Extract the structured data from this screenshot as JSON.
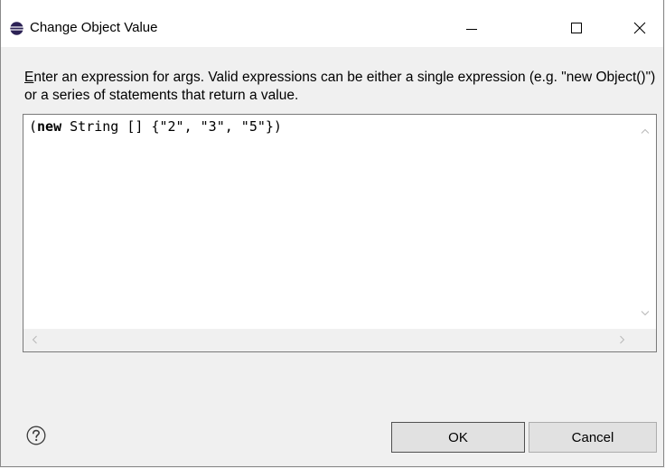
{
  "window": {
    "title": "Change Object Value",
    "icon": "eclipse-icon",
    "controls": {
      "minimize": "minimize-icon",
      "maximize": "maximize-icon",
      "close": "close-icon"
    }
  },
  "instructions": {
    "accel": "E",
    "text_rest": "nter an expression for args. Valid expressions can be either a single expression (e.g. \"new Object()\") or a series of statements that return a value."
  },
  "editor": {
    "keyword": "new",
    "open_paren": "(",
    "code_rest": " String [] {\"2\", \"3\", \"5\"})"
  },
  "footer": {
    "help_icon": "help-icon",
    "ok_label": "OK",
    "cancel_label": "Cancel"
  }
}
